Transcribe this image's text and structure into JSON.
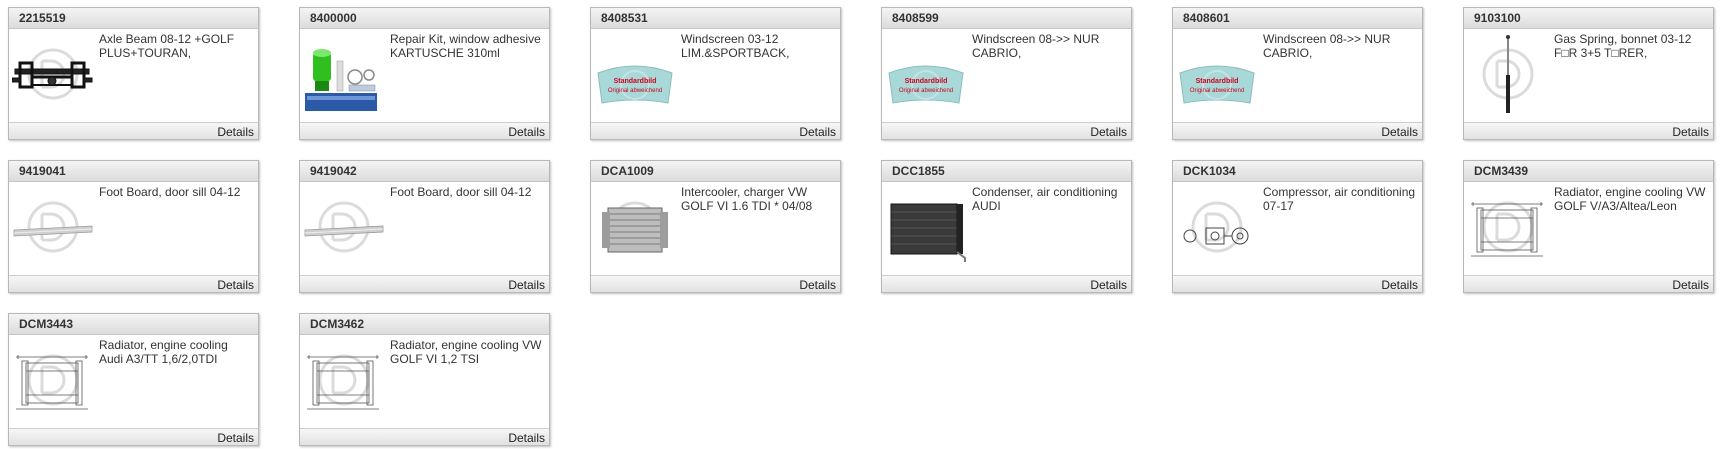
{
  "products": [
    {
      "id": "2215519",
      "description": "Axle Beam 08-12 +GOLF PLUS+TOURAN,",
      "details_label": "Details",
      "image": "axle-beam-photo"
    },
    {
      "id": "8400000",
      "description": "Repair Kit, window adhesive KARTUSCHE 310ml",
      "details_label": "Details",
      "image": "adhesive-kit-photo"
    },
    {
      "id": "8408531",
      "description": "Windscreen 03-12 LIM.&SPORTBACK,",
      "details_label": "Details",
      "image": "windscreen-placeholder"
    },
    {
      "id": "8408599",
      "description": "Windscreen 08->> NUR CABRIO,",
      "details_label": "Details",
      "image": "windscreen-placeholder"
    },
    {
      "id": "8408601",
      "description": "Windscreen 08->> NUR CABRIO,",
      "details_label": "Details",
      "image": "windscreen-placeholder"
    },
    {
      "id": "9103100",
      "description": "Gas Spring, bonnet 03-12 F□R 3+5 T□RER,",
      "details_label": "Details",
      "image": "gas-spring-photo"
    },
    {
      "id": "9419041",
      "description": "Foot Board, door sill 04-12",
      "details_label": "Details",
      "image": "door-sill-photo"
    },
    {
      "id": "9419042",
      "description": "Foot Board, door sill 04-12",
      "details_label": "Details",
      "image": "door-sill-photo"
    },
    {
      "id": "DCA1009",
      "description": "Intercooler, charger VW GOLF VI 1.6 TDI * 04/08",
      "details_label": "Details",
      "image": "intercooler-photo"
    },
    {
      "id": "DCC1855",
      "description": "Condenser, air conditioning AUDI",
      "details_label": "Details",
      "image": "condenser-photo"
    },
    {
      "id": "DCK1034",
      "description": "Compressor, air conditioning 07-17",
      "details_label": "Details",
      "image": "compressor-drawing"
    },
    {
      "id": "DCM3439",
      "description": "Radiator, engine cooling VW GOLF V/A3/Altea/Leon",
      "details_label": "Details",
      "image": "radiator-drawing"
    },
    {
      "id": "DCM3443",
      "description": "Radiator, engine cooling Audi A3/TT 1,6/2,0TDI",
      "details_label": "Details",
      "image": "radiator-drawing-2"
    },
    {
      "id": "DCM3462",
      "description": "Radiator, engine cooling VW GOLF VI 1,2 TSI",
      "details_label": "Details",
      "image": "radiator-drawing-3"
    }
  ],
  "placeholder": {
    "line1": "Standardbild",
    "line2": "Original abweichend"
  },
  "colors": {
    "watermark": "#d6d6d6",
    "placeholder_glass": "#a9d8d8",
    "placeholder_text": "#d0021b",
    "adhesive_green": "#2fbf1f",
    "adhesive_box": "#2a5aa8"
  }
}
